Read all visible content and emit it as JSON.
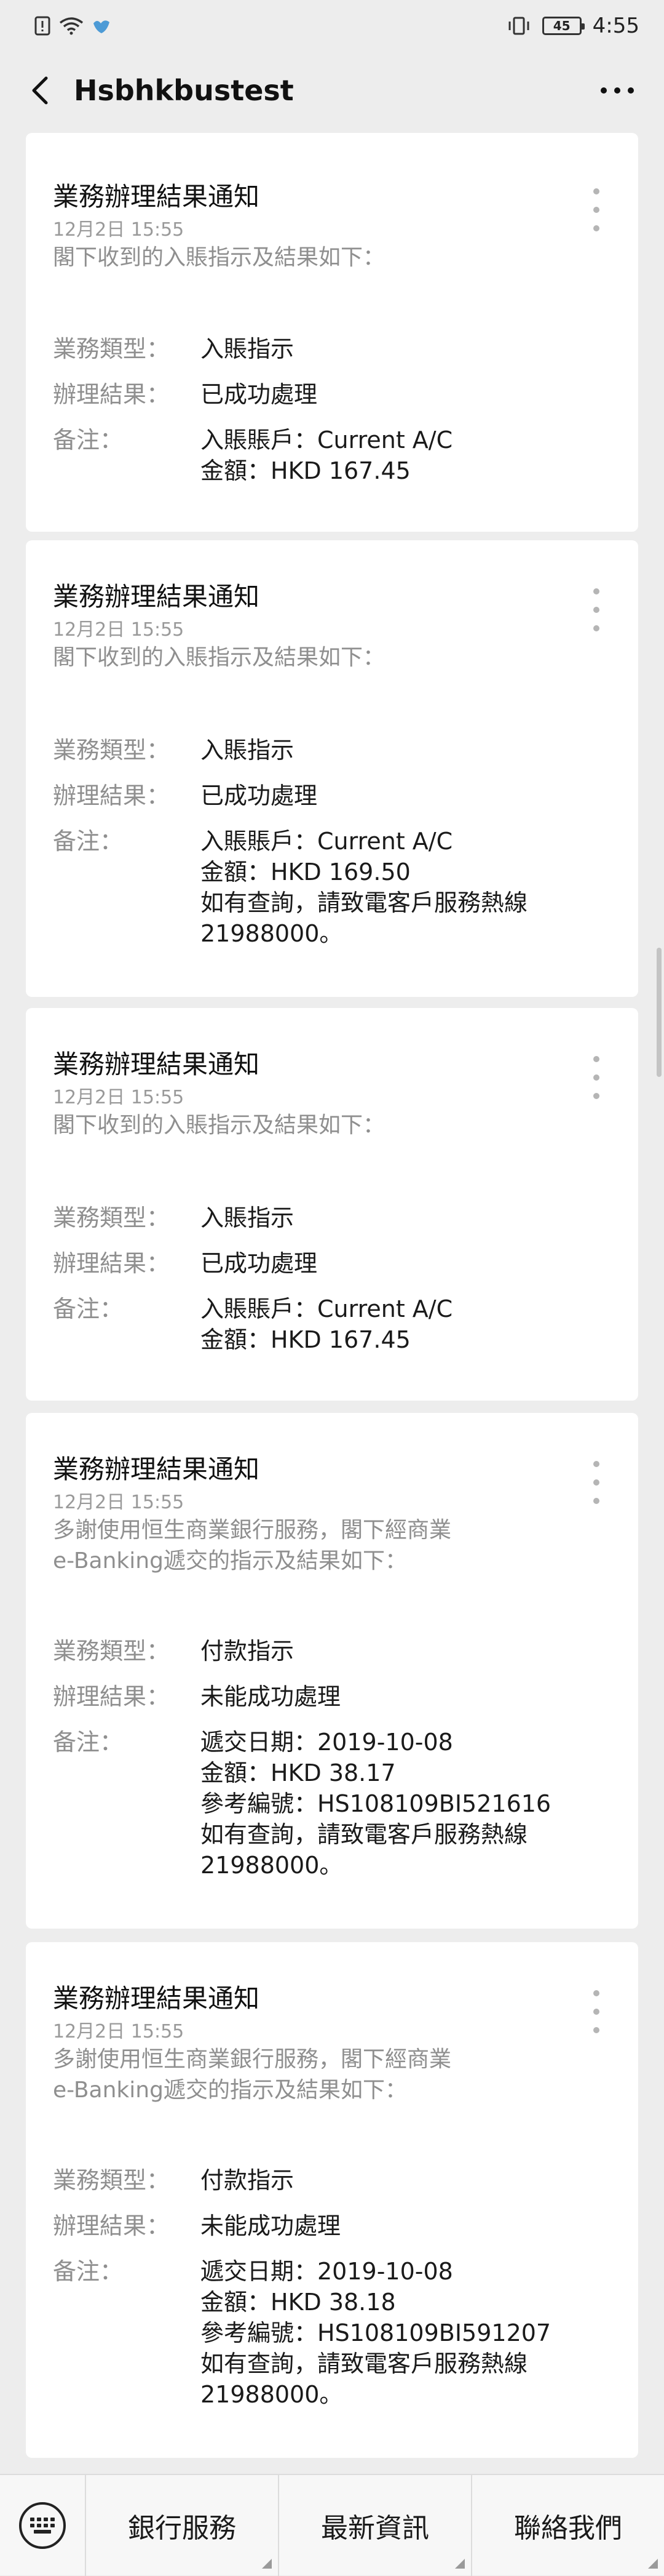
{
  "status_bar": {
    "time": "4:55",
    "battery": "45"
  },
  "header": {
    "title": "Hsbhkbustest"
  },
  "cards": [
    {
      "title": "業務辦理結果通知",
      "time": "12月2日  15:55",
      "intro": "閣下收到的入賬指示及結果如下：",
      "rows": [
        {
          "label": "業務類型：",
          "lines": [
            "入賬指示"
          ]
        },
        {
          "label": "辦理結果：",
          "lines": [
            "已成功處理"
          ]
        },
        {
          "label": "备注：",
          "lines": [
            "入賬賬戶：Current A/C",
            "金額：HKD 167.45"
          ]
        }
      ]
    },
    {
      "title": "業務辦理結果通知",
      "time": "12月2日  15:55",
      "intro": "閣下收到的入賬指示及結果如下：",
      "rows": [
        {
          "label": "業務類型：",
          "lines": [
            "入賬指示"
          ]
        },
        {
          "label": "辦理結果：",
          "lines": [
            "已成功處理"
          ]
        },
        {
          "label": "备注：",
          "lines": [
            "入賬賬戶：Current A/C",
            "金額：HKD 169.50",
            "如有查詢，請致電客戶服務熱線",
            "21988000。"
          ]
        }
      ]
    },
    {
      "title": "業務辦理結果通知",
      "time": "12月2日  15:55",
      "intro": "閣下收到的入賬指示及結果如下：",
      "rows": [
        {
          "label": "業務類型：",
          "lines": [
            "入賬指示"
          ]
        },
        {
          "label": "辦理結果：",
          "lines": [
            "已成功處理"
          ]
        },
        {
          "label": "备注：",
          "lines": [
            "入賬賬戶：Current A/C",
            "金額：HKD 167.45"
          ]
        }
      ]
    },
    {
      "title": "業務辦理結果通知",
      "time": "12月2日  15:55",
      "intro_lines": [
        "多謝使用恒生商業銀行服務，閣下經商業",
        "e-Banking遞交的指示及結果如下："
      ],
      "rows": [
        {
          "label": "業務類型：",
          "lines": [
            "付款指示"
          ]
        },
        {
          "label": "辦理結果：",
          "lines": [
            "未能成功處理"
          ]
        },
        {
          "label": "备注：",
          "lines": [
            "遞交日期：2019-10-08",
            "金額：HKD 38.17",
            "參考編號：HS108109BI521616",
            "如有查詢，請致電客戶服務熱線",
            "21988000。"
          ]
        }
      ]
    },
    {
      "title": "業務辦理結果通知",
      "time": "12月2日  15:55",
      "intro_lines": [
        "多謝使用恒生商業銀行服務，閣下經商業",
        "e-Banking遞交的指示及結果如下："
      ],
      "rows": [
        {
          "label": "業務類型：",
          "lines": [
            "付款指示"
          ]
        },
        {
          "label": "辦理結果：",
          "lines": [
            "未能成功處理"
          ]
        },
        {
          "label": "备注：",
          "lines": [
            "遞交日期：2019-10-08",
            "金額：HKD 38.18",
            "參考編號：HS108109BI591207",
            "如有查詢，請致電客戶服務熱線",
            "21988000。"
          ]
        }
      ]
    }
  ],
  "bottom_menu": {
    "tabs": [
      "銀行服務",
      "最新資訊",
      "聯絡我們"
    ]
  },
  "colors": {
    "page_bg": "#ededed",
    "card_bg": "#ffffff",
    "label_gray": "#8f8f8f",
    "text_dark": "#1a1a1a"
  }
}
